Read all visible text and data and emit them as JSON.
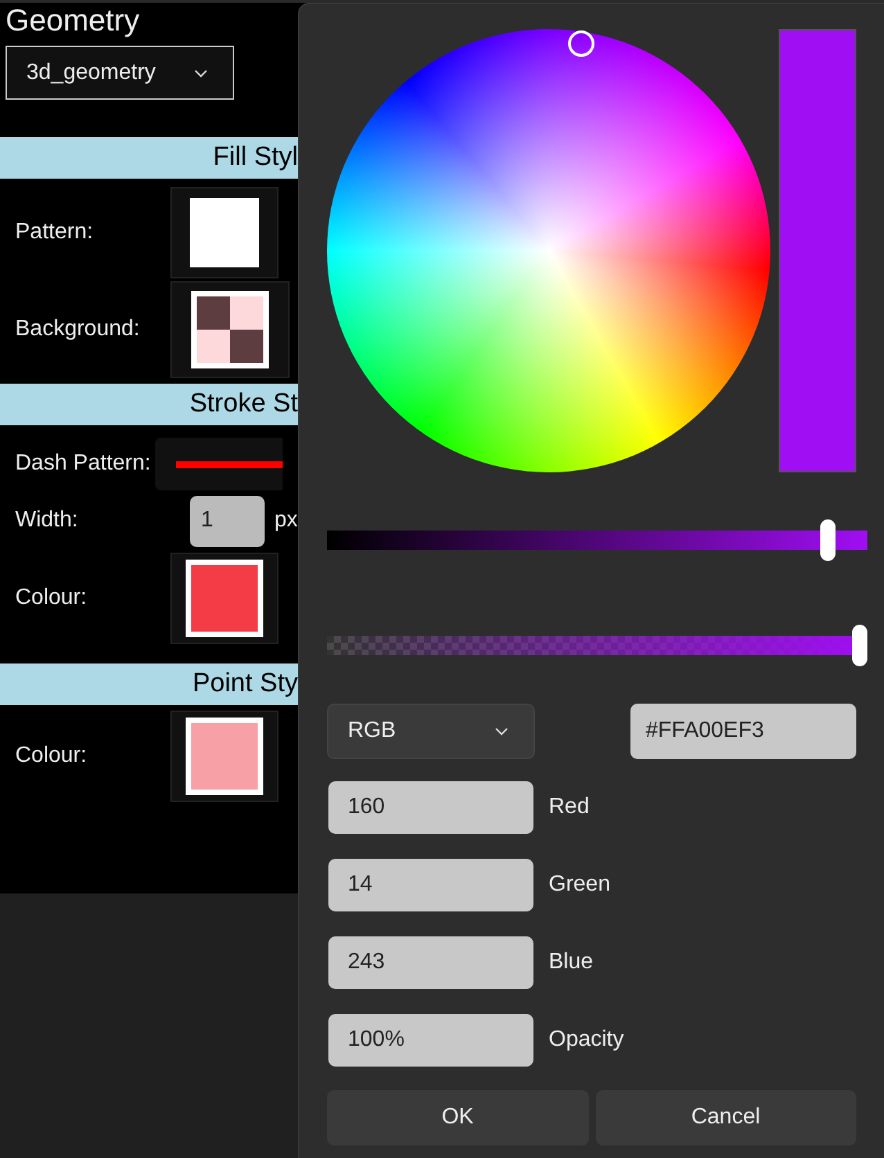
{
  "panel": {
    "title": "Geometry",
    "dropdown": "3d_geometry",
    "sections": [
      {
        "heading": "Fill Styl",
        "rows": [
          {
            "kind": "swatch",
            "label": "Pattern:",
            "color": "#ffffff",
            "framed": false
          },
          {
            "kind": "checker",
            "label": "Background:"
          }
        ]
      },
      {
        "heading": "Stroke St",
        "rows": [
          {
            "kind": "dash",
            "label": "Dash Pattern:",
            "color": "#ff0000"
          },
          {
            "kind": "number",
            "label": "Width:",
            "value": "1",
            "unit": "px"
          },
          {
            "kind": "swatch",
            "label": "Colour:",
            "color": "#f43c46",
            "framed": true
          }
        ]
      },
      {
        "heading": "Point Sty",
        "rows": [
          {
            "kind": "swatch",
            "label": "Colour:",
            "color": "#f7a1a7",
            "framed": true
          }
        ]
      }
    ]
  },
  "picker": {
    "color": "#a00ef3",
    "value_slider": {
      "level": 0.94
    },
    "alpha_slider": {
      "level": 1
    },
    "mode": "RGB",
    "hex": "#FFA00EF3",
    "channels": [
      {
        "value": "160",
        "label": "Red"
      },
      {
        "value": "14",
        "label": "Green"
      },
      {
        "value": "243",
        "label": "Blue"
      },
      {
        "value": "100%",
        "label": "Opacity"
      }
    ],
    "buttons": [
      "OK",
      "Cancel"
    ]
  }
}
